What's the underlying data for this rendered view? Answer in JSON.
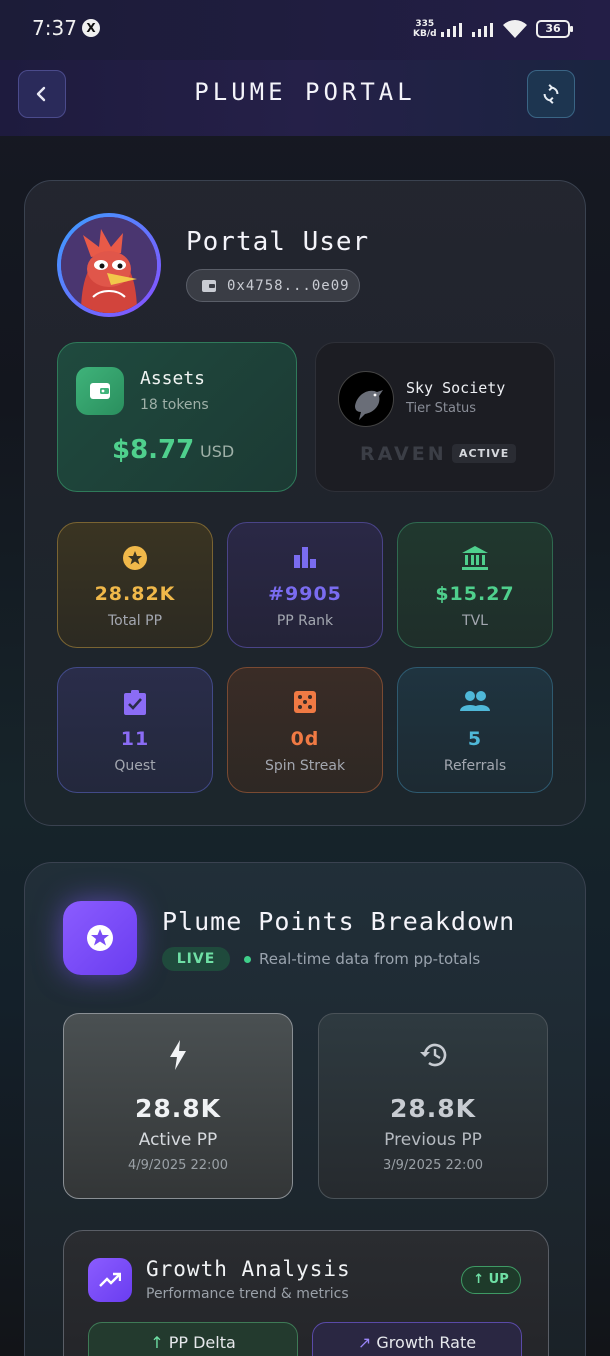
{
  "status_bar": {
    "time": "7:37",
    "net_speed_value": "335",
    "net_speed_unit": "KB/d",
    "battery": "36"
  },
  "header": {
    "title": "PLUME PORTAL"
  },
  "profile": {
    "name": "Portal User",
    "wallet": "0x4758...0e09"
  },
  "assets": {
    "title": "Assets",
    "subtitle": "18 tokens",
    "value": "$8.77",
    "unit": "USD"
  },
  "sky_society": {
    "title": "Sky Society",
    "subtitle": "Tier Status",
    "tier": "RAVEN",
    "badge": "ACTIVE"
  },
  "stats": [
    {
      "value": "28.82K",
      "label": "Total PP",
      "icon": "star-icon",
      "color": "#f0b84a"
    },
    {
      "value": "#9905",
      "label": "PP Rank",
      "icon": "bar-chart-icon",
      "color": "#7a6cf0"
    },
    {
      "value": "$15.27",
      "label": "TVL",
      "icon": "bank-icon",
      "color": "#4fd08d"
    },
    {
      "value": "11",
      "label": "Quest",
      "icon": "clipboard-check-icon",
      "color": "#8b6cf5"
    },
    {
      "value": "0d",
      "label": "Spin Streak",
      "icon": "dice-icon",
      "color": "#f07a44"
    },
    {
      "value": "5",
      "label": "Referrals",
      "icon": "people-icon",
      "color": "#4fb8d8"
    }
  ],
  "breakdown": {
    "title": "Plume Points Breakdown",
    "live_badge": "LIVE",
    "live_text": "Real-time data from pp-totals",
    "active": {
      "value": "28.8K",
      "label": "Active PP",
      "timestamp": "4/9/2025 22:00"
    },
    "previous": {
      "value": "28.8K",
      "label": "Previous PP",
      "timestamp": "3/9/2025 22:00"
    }
  },
  "growth": {
    "title": "Growth Analysis",
    "subtitle": "Performance trend & metrics",
    "badge": "UP",
    "delta_label": "PP Delta",
    "rate_label": "Growth Rate"
  }
}
